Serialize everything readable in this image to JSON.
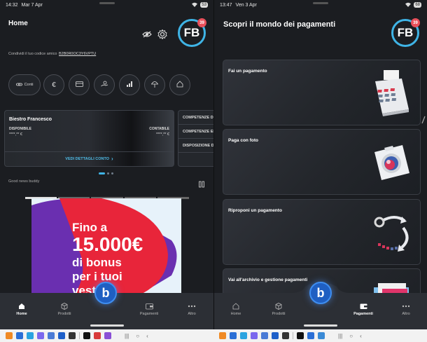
{
  "left": {
    "status": {
      "time": "14:32",
      "date": "Mar 7 Apr",
      "battery": "53"
    },
    "title": "Home",
    "avatar": {
      "initials": "FB",
      "badge": "39"
    },
    "referral": {
      "label": "Condividi il tuo codice amico",
      "code": "B2B0R0OC3Y6VPTU"
    },
    "quick_actions": [
      {
        "label": "Conti",
        "icon": "link-icon"
      },
      {
        "label": "",
        "icon": "euro-icon"
      },
      {
        "label": "",
        "icon": "card-icon"
      },
      {
        "label": "",
        "icon": "savings-icon"
      },
      {
        "label": "",
        "icon": "chart-icon"
      },
      {
        "label": "",
        "icon": "umbrella-icon"
      },
      {
        "label": "",
        "icon": "house-icon"
      }
    ],
    "account": {
      "name": "Biestro Francesco",
      "available_label": "DISPONIBILE",
      "available_value": "****,** €",
      "accounting_label": "CONTABILE",
      "accounting_value": "****,** €",
      "details_link": "VEDI DETTAGLI CONTO"
    },
    "side_card_rows": [
      "COMPETENZE DATE",
      "COMPETENZE ENTR",
      "DISPOSIZIONE DI P"
    ],
    "section_label": "Good news buddy",
    "promo": {
      "line1": "Fino a",
      "line2": "15.000€",
      "line3": "di bonus",
      "line4": "per i tuoi",
      "line5": "vestiti"
    },
    "nav": [
      {
        "label": "Home",
        "active": true
      },
      {
        "label": "Prodotti",
        "active": false
      },
      {
        "label": "Pagamenti",
        "active": false
      },
      {
        "label": "Altro",
        "active": false
      }
    ],
    "fab_letter": "b"
  },
  "right": {
    "status": {
      "time": "13:47",
      "date": "Ven 3 Apr",
      "battery": "68"
    },
    "title": "Scopri il mondo dei pagamenti",
    "avatar": {
      "initials": "FB",
      "badge": "39"
    },
    "cards": [
      {
        "label": "Fai un pagamento",
        "icon": "pos-terminal-icon"
      },
      {
        "label": "Paga con foto",
        "icon": "camera-icon"
      },
      {
        "label": "Riproponi un pagamento",
        "icon": "repeat-icon"
      },
      {
        "label": "Vai all'archivio e gestione pagamenti",
        "icon": "folder-icon"
      }
    ],
    "nav": [
      {
        "label": "Home",
        "active": false
      },
      {
        "label": "Prodotti",
        "active": false
      },
      {
        "label": "Pagamenti",
        "active": true
      },
      {
        "label": "Altro",
        "active": false
      }
    ],
    "fab_letter": "b"
  },
  "colors": {
    "accent": "#3fb4e6",
    "badge": "#e8505b",
    "promo_red": "#e8253a",
    "promo_purple": "#6a2fb0",
    "fab_blue": "#1f5fc2"
  }
}
